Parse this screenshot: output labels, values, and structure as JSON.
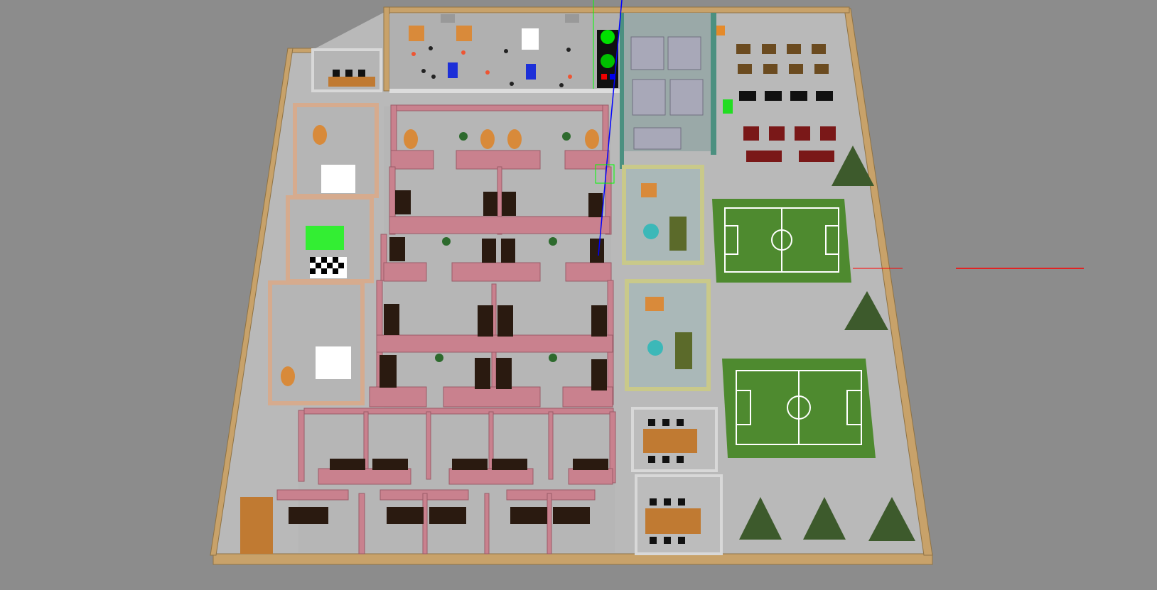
{
  "scene": {
    "background_color": "#8c8c8c",
    "floor_color": "#b4b4b4",
    "outer_wall_color": "#c8a26a",
    "cubicle_wall_color": "#c9818e",
    "inner_wall_color": "#d8d8d8",
    "meeting_wall_color": "#c9c98a",
    "lab_wall_color": "#d6ab8e",
    "field_color": "#4e8a2f",
    "gym_wall_color": "#4b9080",
    "axis_colors": {
      "x": "#ff0000",
      "y": "#00ff00",
      "z": "#0000ff"
    },
    "zones": [
      "robot-lab",
      "cafeteria",
      "lounge",
      "sensor-calibration-rooms",
      "open-office-cubicles",
      "meeting-rooms",
      "soccer-field-1",
      "soccer-field-2",
      "conference-rooms",
      "lower-offices"
    ],
    "icons": {
      "tree": "pine-tree-icon",
      "plant": "potted-plant-icon",
      "robot": "green-robot-icon",
      "chair": "office-chair-icon",
      "desk": "desk-icon"
    }
  }
}
